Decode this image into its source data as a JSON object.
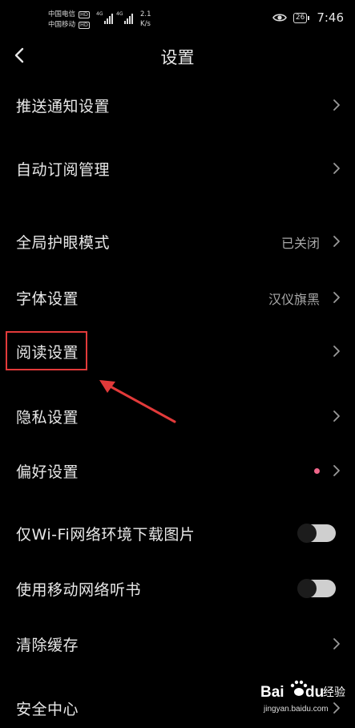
{
  "status_bar": {
    "carrier1": "中国电信",
    "carrier2": "中国移动",
    "hd": "HD",
    "net1": "4G",
    "net2": "4G",
    "speed_value": "2.1",
    "speed_unit": "K/s",
    "battery": "26",
    "time": "7:46"
  },
  "header": {
    "title": "设置",
    "back_icon": "chevron-left-icon"
  },
  "rows": [
    {
      "label": "推送通知设置",
      "type": "nav"
    },
    {
      "label": "自动订阅管理",
      "type": "nav"
    },
    {
      "label": "全局护眼模式",
      "value": "已关闭",
      "type": "nav"
    },
    {
      "label": "字体设置",
      "value": "汉仪旗黑",
      "type": "nav"
    },
    {
      "label": "阅读设置",
      "type": "nav",
      "highlighted": true
    },
    {
      "label": "隐私设置",
      "type": "nav"
    },
    {
      "label": "偏好设置",
      "type": "nav",
      "badge": "red-dot"
    },
    {
      "label": "仅Wi-Fi网络环境下载图片",
      "type": "toggle",
      "on": false
    },
    {
      "label": "使用移动网络听书",
      "type": "toggle",
      "on": false
    },
    {
      "label": "清除缓存",
      "type": "nav"
    },
    {
      "label": "安全中心",
      "type": "nav"
    }
  ],
  "watermark": {
    "brand": "Bai",
    "brand2": "du",
    "suffix": "经验",
    "url": "jingyan.baidu.com"
  },
  "colors": {
    "background": "#000000",
    "text": "#e8e8e8",
    "secondary_text": "#a8a8a8",
    "annotation": "#e23a3a",
    "badge_dot": "#f0668a"
  }
}
